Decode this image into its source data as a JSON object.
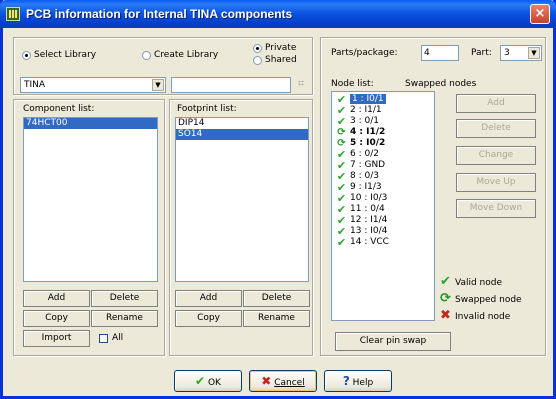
{
  "window": {
    "title": "PCB information for Internal TINA components",
    "close_glyph": "×",
    "icon": "tina-app-icon"
  },
  "library": {
    "select_label": "Select Library",
    "create_label": "Create Library",
    "private_label": "Private",
    "shared_label": "Shared",
    "combo_value": "TINA",
    "second_field_value": "",
    "browse_icon": "browse-icon"
  },
  "component_list": {
    "label": "Component list:",
    "items": [
      "74HCT00"
    ],
    "selected": "74HCT00",
    "buttons": {
      "add": "Add",
      "delete": "Delete",
      "copy": "Copy",
      "rename": "Rename",
      "import": "Import",
      "all": "All"
    }
  },
  "footprint_list": {
    "label": "Footprint list:",
    "items": [
      "DIP14",
      "SO14"
    ],
    "selected": "SO14",
    "buttons": {
      "add": "Add",
      "delete": "Delete",
      "copy": "Copy",
      "rename": "Rename"
    }
  },
  "parts": {
    "parts_label": "Parts/package:",
    "parts_value": "4",
    "part_label": "Part:",
    "part_value": "3"
  },
  "nodes": {
    "list_label": "Node list:",
    "swapped_label": "Swapped nodes",
    "items": [
      {
        "label": "1 : I0/1",
        "status": "valid",
        "selected": true
      },
      {
        "label": "2 : I1/1",
        "status": "valid"
      },
      {
        "label": "3 : 0/1",
        "status": "valid"
      },
      {
        "label": "4 : I1/2",
        "status": "swapped",
        "bold": true
      },
      {
        "label": "5 : I0/2",
        "status": "swapped",
        "bold": true
      },
      {
        "label": "6 : 0/2",
        "status": "valid"
      },
      {
        "label": "7 : GND",
        "status": "valid"
      },
      {
        "label": "8 : 0/3",
        "status": "valid"
      },
      {
        "label": "9 : I1/3",
        "status": "valid"
      },
      {
        "label": "10 : I0/3",
        "status": "valid"
      },
      {
        "label": "11 : 0/4",
        "status": "valid"
      },
      {
        "label": "12 : I1/4",
        "status": "valid"
      },
      {
        "label": "13 : I0/4",
        "status": "valid"
      },
      {
        "label": "14 : VCC",
        "status": "valid"
      }
    ],
    "buttons": {
      "add": "Add",
      "delete": "Delete",
      "change": "Change",
      "move_up": "Move Up",
      "move_down": "Move Down"
    },
    "legend": {
      "valid": "Valid node",
      "swapped": "Swapped node",
      "invalid": "Invalid node"
    },
    "clear_button": "Clear pin swap"
  },
  "footer": {
    "ok": "OK",
    "cancel": "Cancel",
    "help": "Help"
  },
  "colors": {
    "titlebar": "#0A5CF4",
    "selection": "#316AC5",
    "valid": "#2BA52B",
    "invalid": "#C0281E",
    "dialog_bg": "#ECE9D8"
  }
}
